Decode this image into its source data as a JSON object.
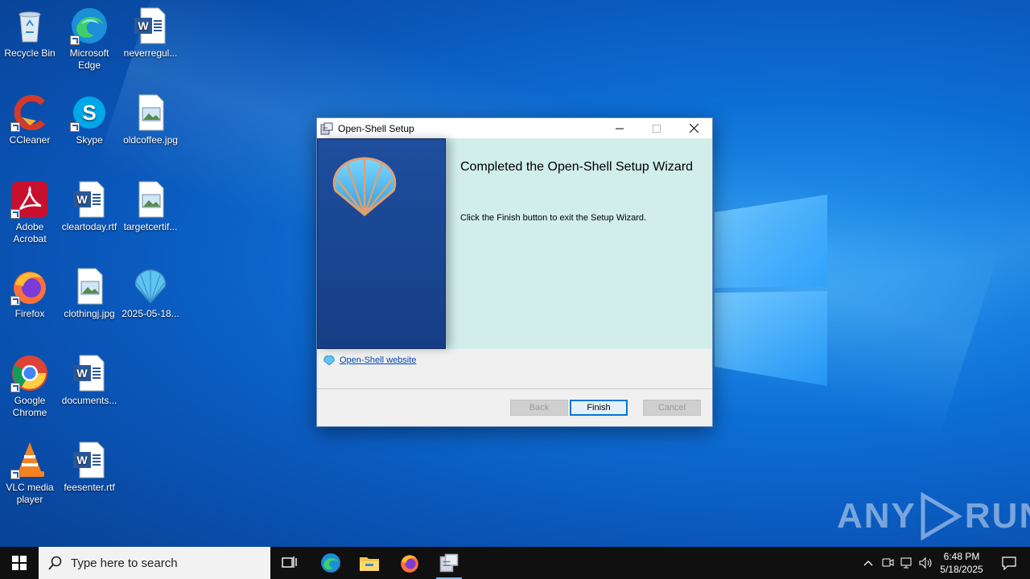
{
  "desktop": {
    "icons": [
      {
        "label": "Recycle Bin",
        "icon": "recycle-bin-icon"
      },
      {
        "label": "Microsoft Edge",
        "icon": "edge-icon"
      },
      {
        "label": "neverregul...",
        "icon": "word-document-icon"
      },
      {
        "label": "CCleaner",
        "icon": "ccleaner-icon"
      },
      {
        "label": "Skype",
        "icon": "skype-icon"
      },
      {
        "label": "oldcoffee.jpg",
        "icon": "image-file-icon"
      },
      {
        "label": "Adobe Acrobat",
        "icon": "acrobat-icon"
      },
      {
        "label": "cleartoday.rtf",
        "icon": "word-document-icon"
      },
      {
        "label": "targetcertif...",
        "icon": "image-file-icon"
      },
      {
        "label": "Firefox",
        "icon": "firefox-icon"
      },
      {
        "label": "clothingj.jpg",
        "icon": "image-file-icon"
      },
      {
        "label": "2025-05-18...",
        "icon": "open-shell-icon"
      },
      {
        "label": "Google Chrome",
        "icon": "chrome-icon"
      },
      {
        "label": "documents...",
        "icon": "word-document-icon"
      },
      {
        "label": "VLC media player",
        "icon": "vlc-icon"
      },
      {
        "label": "feesenter.rtf",
        "icon": "word-document-icon"
      }
    ]
  },
  "dialog": {
    "title": "Open-Shell Setup",
    "heading": "Completed the Open-Shell Setup Wizard",
    "message": "Click the Finish button to exit the Setup Wizard.",
    "link": "Open-Shell website",
    "buttons": {
      "back": "Back",
      "finish": "Finish",
      "cancel": "Cancel"
    },
    "minimize": "—",
    "maximize": "☐",
    "close": "✕"
  },
  "watermark": {
    "left": "ANY",
    "right": "RUN"
  },
  "taskbar": {
    "search_placeholder": "Type here to search",
    "apps": [
      "task-view-icon",
      "edge-icon",
      "file-explorer-icon",
      "firefox-icon",
      "open-shell-setup-icon"
    ],
    "tray_chevron": "^",
    "time": "6:48 PM",
    "date": "5/18/2025"
  },
  "colors": {
    "accent": "#0078d7",
    "banner": "#d1eeea",
    "side_panel": "#1e4e9e",
    "link": "#0645ad"
  }
}
